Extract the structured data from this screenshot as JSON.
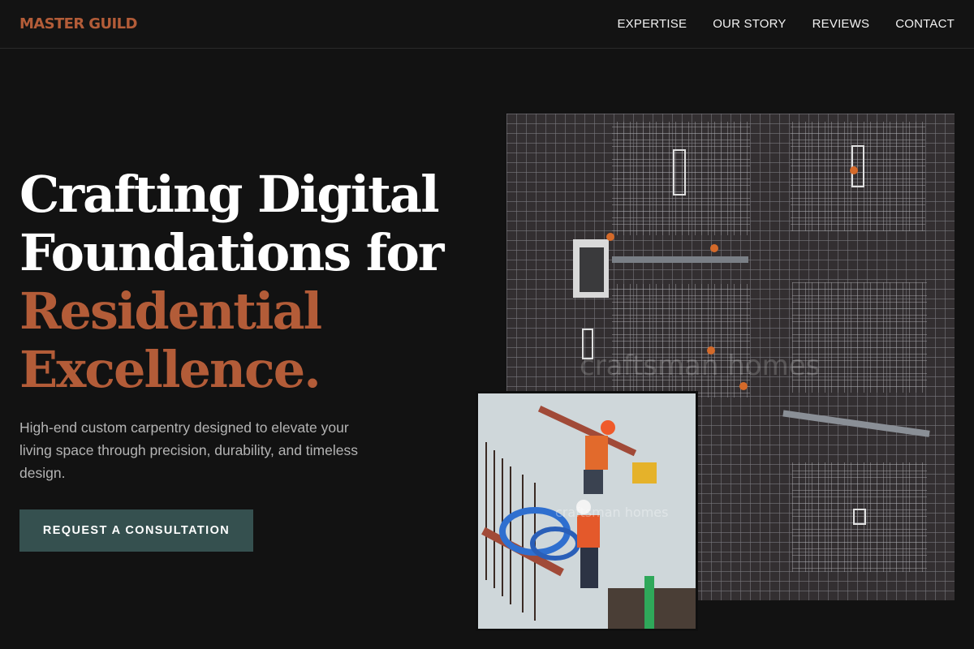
{
  "header": {
    "brand": "MASTER GUILD",
    "nav": [
      "EXPERTISE",
      "OUR STORY",
      "REVIEWS",
      "CONTACT"
    ]
  },
  "hero": {
    "headline_lines": [
      "Crafting Digital",
      "Foundations for"
    ],
    "headline_accent_lines": [
      "Residential",
      "Excellence."
    ],
    "subtext": "High-end custom carpentry designed to elevate your living space through precision, durability, and timeless design.",
    "cta_label": "REQUEST A CONSULTATION"
  },
  "images": {
    "main_watermark": "craftsman homes",
    "secondary_watermark": "craftsman homes"
  },
  "colors": {
    "background": "#121212",
    "accent": "#b35c38",
    "button": "#35504f",
    "subtext": "#b4b4b4"
  }
}
